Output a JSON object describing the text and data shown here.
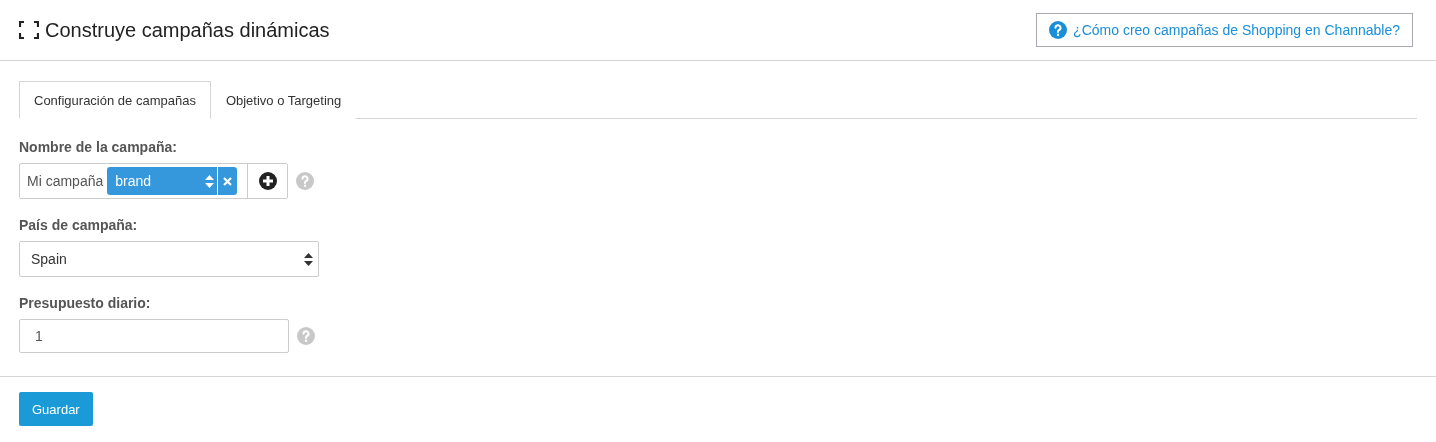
{
  "header": {
    "title": "Construye campañas dinámicas",
    "help_link": "¿Cómo creo campañas de Shopping en Channable?"
  },
  "tabs": [
    {
      "label": "Configuración de campañas",
      "selected": true
    },
    {
      "label": "Objetivo o Targeting",
      "selected": false
    }
  ],
  "fields": [
    {
      "kind": "composite",
      "label": "Nombre de la campaña:",
      "prefix": "Mi campaña",
      "token": "brand",
      "help": true
    },
    {
      "kind": "select",
      "label": "País de campaña:",
      "value": "Spain",
      "help": false
    },
    {
      "kind": "text",
      "label": "Presupuesto diario:",
      "value": "1",
      "help": true
    }
  ],
  "save_button": "Guardar"
}
